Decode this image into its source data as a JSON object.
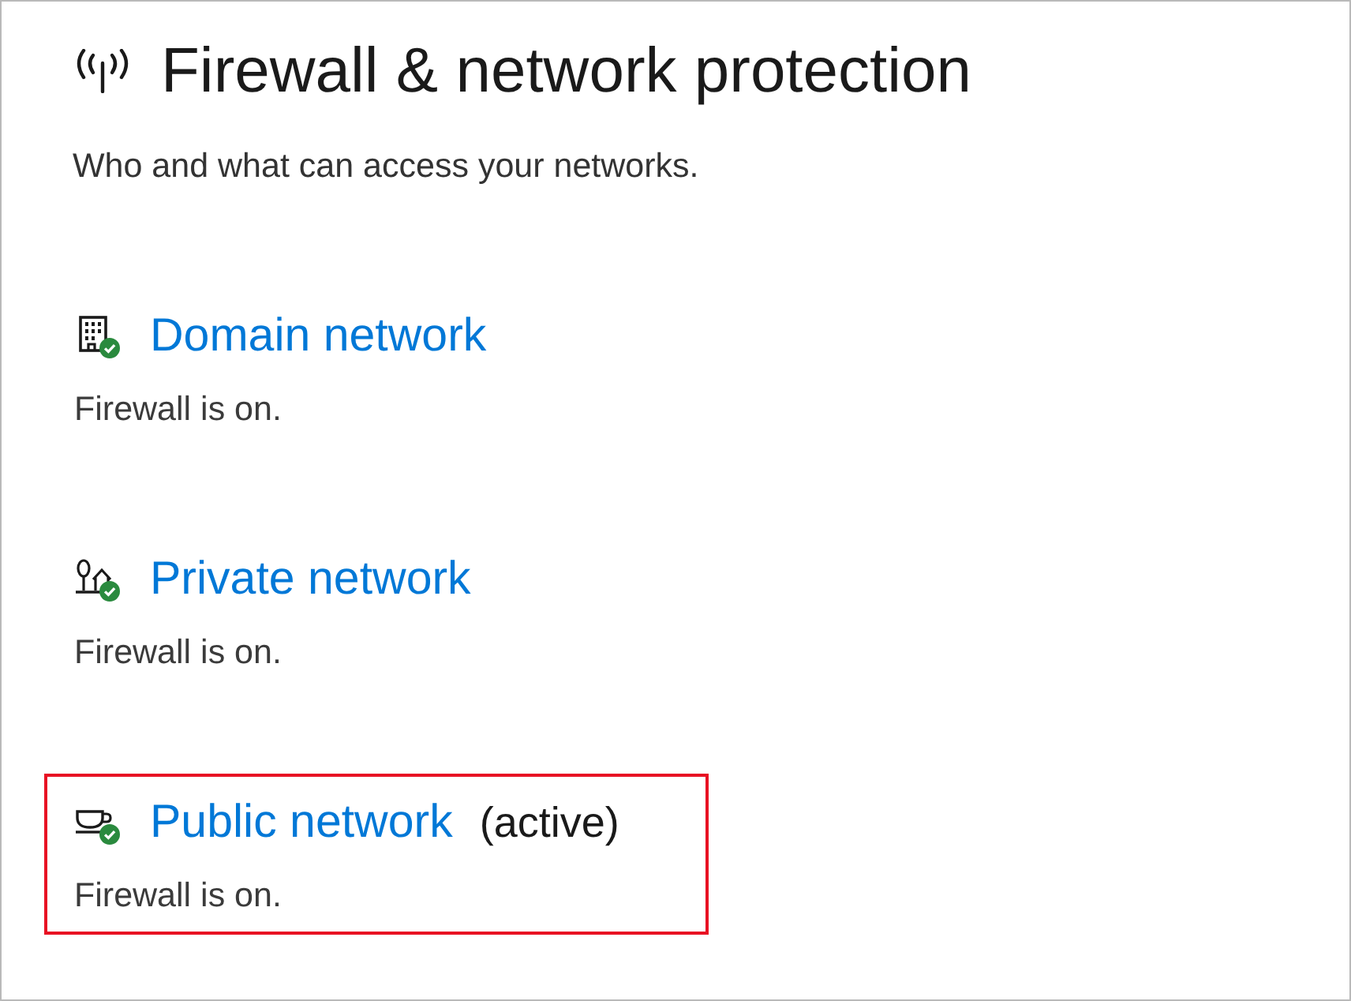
{
  "header": {
    "title": "Firewall & network protection",
    "subtitle": "Who and what can access your networks."
  },
  "networks": [
    {
      "kind": "domain",
      "name": "Domain network",
      "firewall_on": true,
      "status": "Firewall is on.",
      "highlighted": false
    },
    {
      "kind": "private",
      "name": "Private network",
      "firewall_on": true,
      "status": "Firewall is on.",
      "highlighted": false
    },
    {
      "kind": "public",
      "name": "Public network",
      "active_label": "(active)",
      "firewall_on": true,
      "status": "Firewall is on.",
      "highlighted": true
    }
  ]
}
